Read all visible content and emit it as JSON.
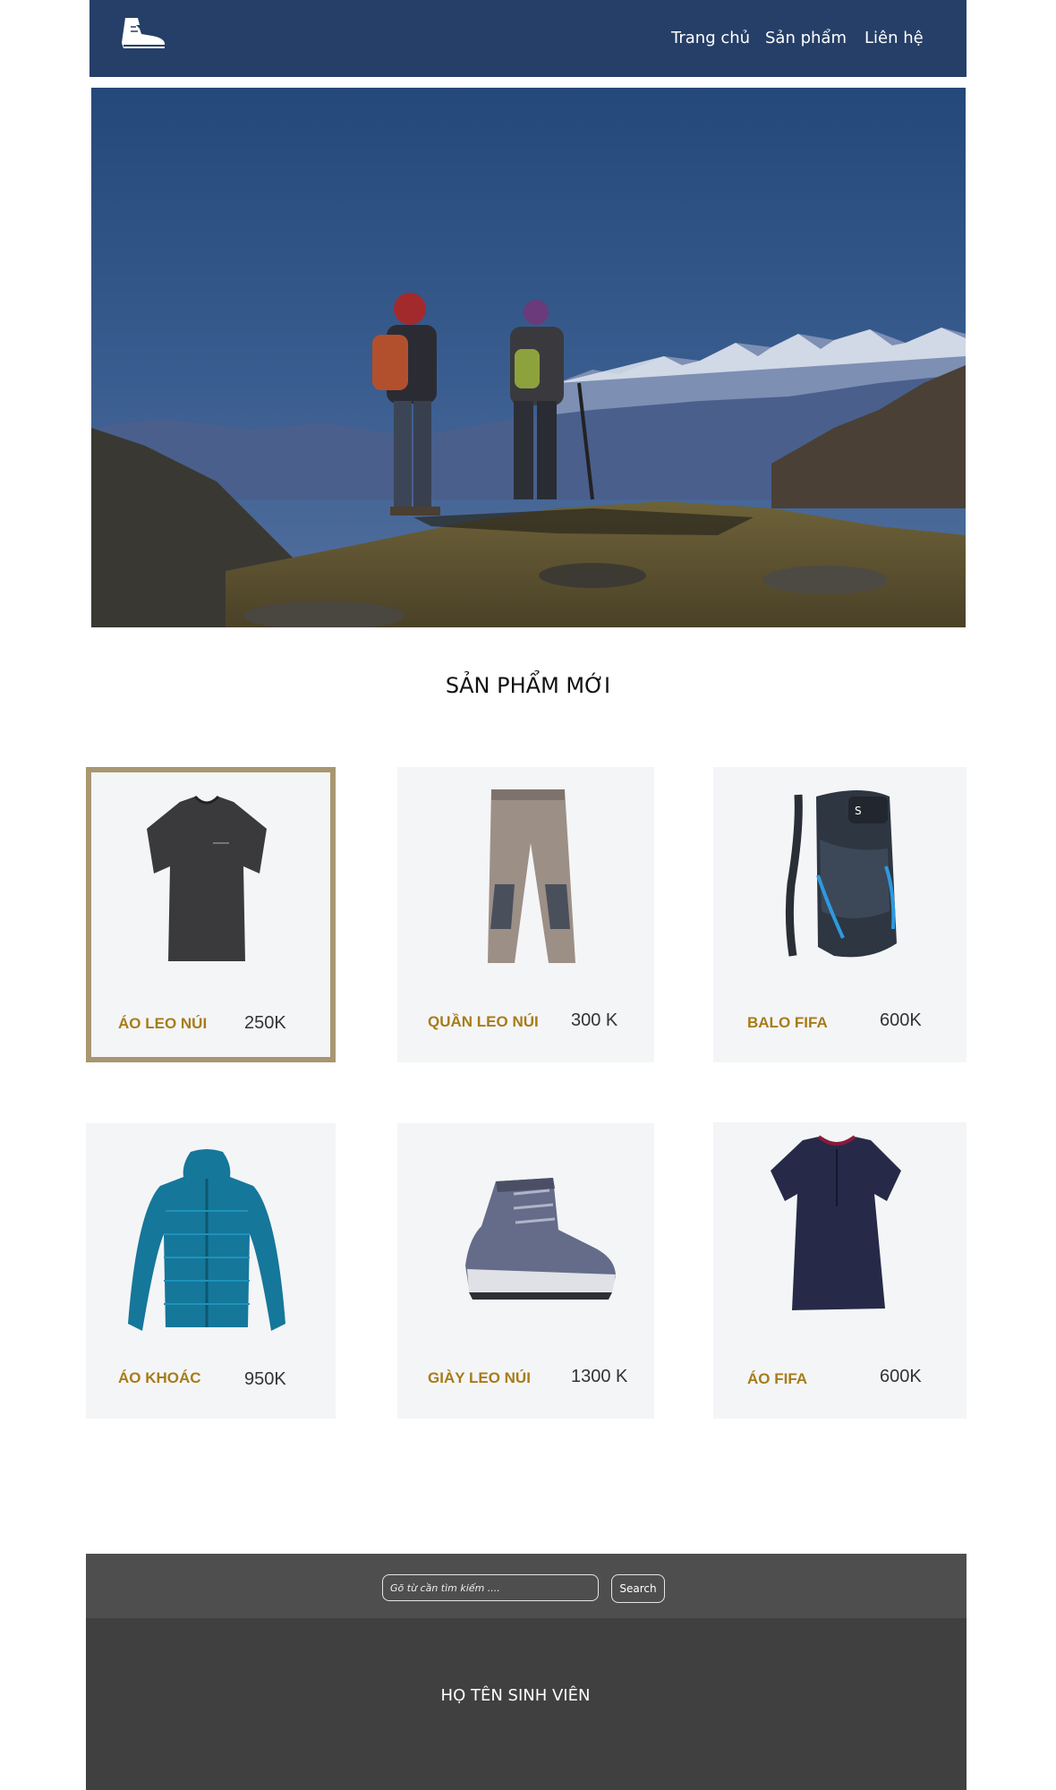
{
  "header": {
    "logo_icon": "hiking-boot-icon",
    "bg_color": "#263f68",
    "nav": [
      {
        "label": "Trang chủ"
      },
      {
        "label": "Sản phẩm"
      },
      {
        "label": "Liên hệ"
      }
    ]
  },
  "section": {
    "title": "SẢN PHẨM MỚI"
  },
  "products": [
    {
      "name": "ÁO  LEO NÚI",
      "price": "250K",
      "icon": "tshirt-icon",
      "selected": true
    },
    {
      "name": "QUẦN LEO NÚI",
      "price": "300 K",
      "icon": "pants-icon"
    },
    {
      "name": "BALO FIFA",
      "price": "600K",
      "icon": "backpack-icon"
    },
    {
      "name": "ÁO  KHOÁC",
      "price": "950K",
      "icon": "jacket-icon"
    },
    {
      "name": "GIÀY LEO NÚI",
      "price": "1300 K",
      "icon": "hiking-boot-icon"
    },
    {
      "name": "ÁO FIFA",
      "price": "600K",
      "icon": "womens-shirt-icon"
    }
  ],
  "search": {
    "placeholder": "Gõ từ cần tìm kiếm ....",
    "button_label": "Search"
  },
  "footer": {
    "text": "HỌ TÊN SINH VIÊN"
  },
  "colors": {
    "accent": "#a77c18",
    "selected_border": "#a89670",
    "card_bg": "#f4f5f7",
    "search_bg": "#4e4e4e",
    "footer_bg": "#404040"
  }
}
